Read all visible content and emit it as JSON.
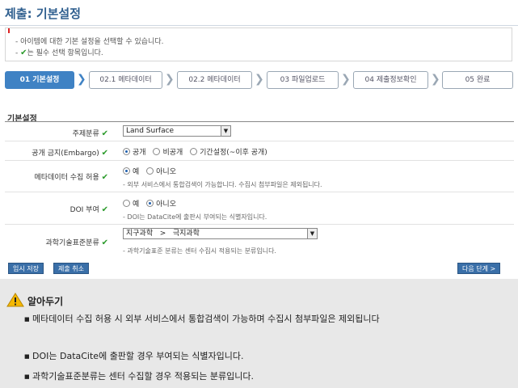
{
  "page_title": "제출: 기본설정",
  "notice": {
    "line1": "- 아이템에 대한 기본 설정을 선택할 수 있습니다.",
    "line2_prefix": "- ",
    "line2_suffix": "는 필수 선택 항목입니다."
  },
  "steps": [
    {
      "label": "01 기본설정",
      "active": true
    },
    {
      "label": "02.1 메타데이터",
      "active": false
    },
    {
      "label": "02.2 메타데이터",
      "active": false
    },
    {
      "label": "03 파일업로드",
      "active": false
    },
    {
      "label": "04 제출정보확인",
      "active": false
    },
    {
      "label": "05 완료",
      "active": false
    }
  ],
  "section_title": "기본설정",
  "form": {
    "subject": {
      "label": "주제분류",
      "value": "Land Surface"
    },
    "embargo": {
      "label": "공개 금지(Embargo)",
      "options": [
        "공개",
        "비공개",
        "기간설정(~이후 공개)"
      ],
      "selected": "공개"
    },
    "harvest": {
      "label": "메타데이터 수집 허용",
      "options": [
        "예",
        "아니오"
      ],
      "selected": "예",
      "help": "- 외부 서비스에서 통합검색이 가능합니다. 수집시 첨부파일은 제외됩니다."
    },
    "doi": {
      "label": "DOI 부여",
      "options": [
        "예",
        "아니오"
      ],
      "selected": "아니오",
      "help": "- DOI는 DataCite에 출판시 부여되는 식별자입니다."
    },
    "standard": {
      "label": "과학기술표준분류",
      "value": "지구과학   >   극지과학",
      "help": "- 과학기술표준 분류는 센터 수집시 적용되는 분류입니다."
    }
  },
  "buttons": {
    "temp_save": "임시 저장",
    "cancel": "제출 취소",
    "next": "다음 단계 >"
  },
  "info": {
    "heading": "알아두기",
    "bullets": [
      "메타데이터 수집 허용 시 외부 서비스에서 통합검색이 가능하며 수집시 첨부파일은 제외됩니다",
      "DOI는 DataCite에 출판할 경우 부여되는 식별자입니다.",
      "과학기술표준분류는 센터 수집할 경우 적용되는 분류입니다."
    ]
  },
  "colors": {
    "accent": "#3f82c4",
    "check": "#2a9a2a",
    "title": "#2f5f8f"
  },
  "icons": {
    "required": "check-icon",
    "warning": "warning-icon",
    "step_arrow": "chevron-right-icon"
  }
}
